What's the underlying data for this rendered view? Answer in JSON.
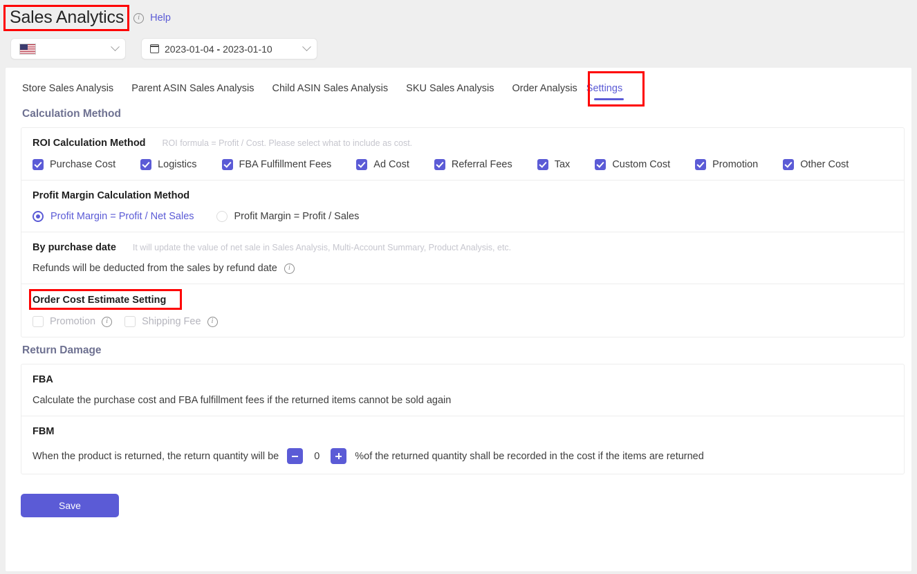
{
  "header": {
    "title": "Sales Analytics",
    "info_icon": "info-circle-icon",
    "help_label": "Help",
    "market_select": {
      "icon": "us-flag-icon",
      "value": "",
      "chevron": "chevron-down-icon"
    },
    "date_select": {
      "icon": "calendar-icon",
      "start": "2023-01-04",
      "separator": "-",
      "end": "2023-01-10",
      "chevron": "chevron-down-icon"
    }
  },
  "tabs": [
    {
      "label": "Store Sales Analysis",
      "active": false
    },
    {
      "label": "Parent ASIN Sales Analysis",
      "active": false
    },
    {
      "label": "Child ASIN Sales Analysis",
      "active": false
    },
    {
      "label": "SKU Sales Analysis",
      "active": false
    },
    {
      "label": "Order Analysis",
      "active": false
    },
    {
      "label": "Settings",
      "active": true
    }
  ],
  "calculation_method": {
    "section_title": "Calculation Method",
    "roi": {
      "heading": "ROI Calculation Method",
      "hint": "ROI formula = Profit / Cost. Please select what to include as cost.",
      "options": [
        {
          "label": "Purchase Cost",
          "checked": true
        },
        {
          "label": "Logistics",
          "checked": true
        },
        {
          "label": "FBA Fulfillment Fees",
          "checked": true
        },
        {
          "label": "Ad Cost",
          "checked": true
        },
        {
          "label": "Referral Fees",
          "checked": true
        },
        {
          "label": "Tax",
          "checked": true
        },
        {
          "label": "Custom Cost",
          "checked": true
        },
        {
          "label": "Promotion",
          "checked": true
        },
        {
          "label": "Other Cost",
          "checked": true
        }
      ]
    },
    "profit_margin": {
      "heading": "Profit Margin Calculation Method",
      "options": [
        {
          "label": "Profit Margin = Profit / Net Sales",
          "selected": true
        },
        {
          "label": "Profit Margin = Profit / Sales",
          "selected": false
        }
      ]
    },
    "purchase_date": {
      "heading": "By purchase date",
      "hint": "It will update the value of net sale in Sales Analysis, Multi-Account Summary, Product Analysis, etc.",
      "note": "Refunds will be deducted from the sales by refund date",
      "note_icon": "info-circle-icon"
    },
    "order_cost_estimate": {
      "heading": "Order Cost Estimate Setting",
      "options": [
        {
          "label": "Promotion",
          "checked": false,
          "icon": "info-circle-icon"
        },
        {
          "label": "Shipping Fee",
          "checked": false,
          "icon": "info-circle-icon"
        }
      ]
    }
  },
  "return_damage": {
    "section_title": "Return Damage",
    "fba": {
      "heading": "FBA",
      "text": "Calculate the purchase cost and FBA fulfillment fees if the returned items cannot be sold again"
    },
    "fbm": {
      "heading": "FBM",
      "text_before": "When the product is returned, the return quantity will be",
      "decrement_label": "-",
      "value": "0",
      "increment_label": "+",
      "text_after": "%of the returned quantity shall be recorded in the cost if the items are returned"
    }
  },
  "footer": {
    "save_label": "Save"
  },
  "colors": {
    "accent": "#5b5bd6",
    "annotation": "#fe0000",
    "section_title": "#6e7191",
    "hint": "#c6c6ce",
    "page_bg": "#efefef"
  }
}
